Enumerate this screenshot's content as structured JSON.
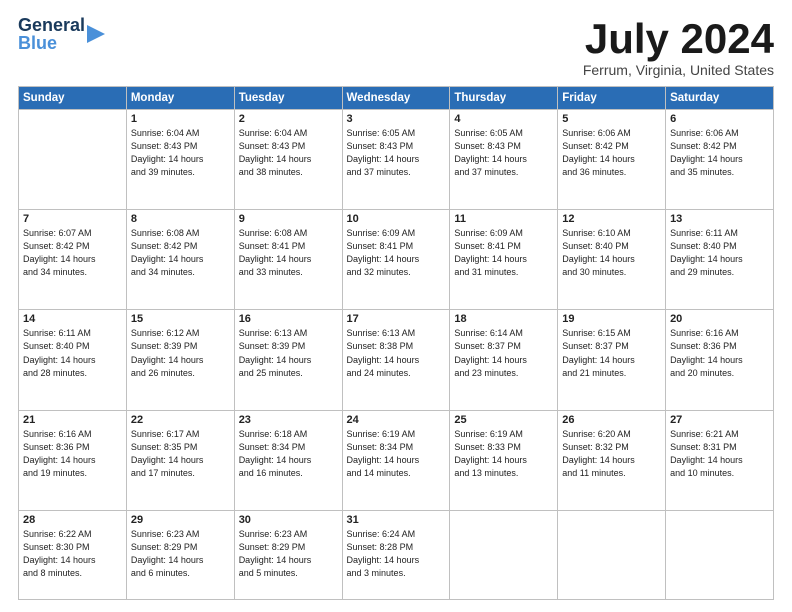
{
  "header": {
    "logo_general": "General",
    "logo_blue": "Blue",
    "month_title": "July 2024",
    "location": "Ferrum, Virginia, United States"
  },
  "days_of_week": [
    "Sunday",
    "Monday",
    "Tuesday",
    "Wednesday",
    "Thursday",
    "Friday",
    "Saturday"
  ],
  "weeks": [
    [
      {
        "day": "",
        "info": ""
      },
      {
        "day": "1",
        "info": "Sunrise: 6:04 AM\nSunset: 8:43 PM\nDaylight: 14 hours\nand 39 minutes."
      },
      {
        "day": "2",
        "info": "Sunrise: 6:04 AM\nSunset: 8:43 PM\nDaylight: 14 hours\nand 38 minutes."
      },
      {
        "day": "3",
        "info": "Sunrise: 6:05 AM\nSunset: 8:43 PM\nDaylight: 14 hours\nand 37 minutes."
      },
      {
        "day": "4",
        "info": "Sunrise: 6:05 AM\nSunset: 8:43 PM\nDaylight: 14 hours\nand 37 minutes."
      },
      {
        "day": "5",
        "info": "Sunrise: 6:06 AM\nSunset: 8:42 PM\nDaylight: 14 hours\nand 36 minutes."
      },
      {
        "day": "6",
        "info": "Sunrise: 6:06 AM\nSunset: 8:42 PM\nDaylight: 14 hours\nand 35 minutes."
      }
    ],
    [
      {
        "day": "7",
        "info": "Sunrise: 6:07 AM\nSunset: 8:42 PM\nDaylight: 14 hours\nand 34 minutes."
      },
      {
        "day": "8",
        "info": "Sunrise: 6:08 AM\nSunset: 8:42 PM\nDaylight: 14 hours\nand 34 minutes."
      },
      {
        "day": "9",
        "info": "Sunrise: 6:08 AM\nSunset: 8:41 PM\nDaylight: 14 hours\nand 33 minutes."
      },
      {
        "day": "10",
        "info": "Sunrise: 6:09 AM\nSunset: 8:41 PM\nDaylight: 14 hours\nand 32 minutes."
      },
      {
        "day": "11",
        "info": "Sunrise: 6:09 AM\nSunset: 8:41 PM\nDaylight: 14 hours\nand 31 minutes."
      },
      {
        "day": "12",
        "info": "Sunrise: 6:10 AM\nSunset: 8:40 PM\nDaylight: 14 hours\nand 30 minutes."
      },
      {
        "day": "13",
        "info": "Sunrise: 6:11 AM\nSunset: 8:40 PM\nDaylight: 14 hours\nand 29 minutes."
      }
    ],
    [
      {
        "day": "14",
        "info": "Sunrise: 6:11 AM\nSunset: 8:40 PM\nDaylight: 14 hours\nand 28 minutes."
      },
      {
        "day": "15",
        "info": "Sunrise: 6:12 AM\nSunset: 8:39 PM\nDaylight: 14 hours\nand 26 minutes."
      },
      {
        "day": "16",
        "info": "Sunrise: 6:13 AM\nSunset: 8:39 PM\nDaylight: 14 hours\nand 25 minutes."
      },
      {
        "day": "17",
        "info": "Sunrise: 6:13 AM\nSunset: 8:38 PM\nDaylight: 14 hours\nand 24 minutes."
      },
      {
        "day": "18",
        "info": "Sunrise: 6:14 AM\nSunset: 8:37 PM\nDaylight: 14 hours\nand 23 minutes."
      },
      {
        "day": "19",
        "info": "Sunrise: 6:15 AM\nSunset: 8:37 PM\nDaylight: 14 hours\nand 21 minutes."
      },
      {
        "day": "20",
        "info": "Sunrise: 6:16 AM\nSunset: 8:36 PM\nDaylight: 14 hours\nand 20 minutes."
      }
    ],
    [
      {
        "day": "21",
        "info": "Sunrise: 6:16 AM\nSunset: 8:36 PM\nDaylight: 14 hours\nand 19 minutes."
      },
      {
        "day": "22",
        "info": "Sunrise: 6:17 AM\nSunset: 8:35 PM\nDaylight: 14 hours\nand 17 minutes."
      },
      {
        "day": "23",
        "info": "Sunrise: 6:18 AM\nSunset: 8:34 PM\nDaylight: 14 hours\nand 16 minutes."
      },
      {
        "day": "24",
        "info": "Sunrise: 6:19 AM\nSunset: 8:34 PM\nDaylight: 14 hours\nand 14 minutes."
      },
      {
        "day": "25",
        "info": "Sunrise: 6:19 AM\nSunset: 8:33 PM\nDaylight: 14 hours\nand 13 minutes."
      },
      {
        "day": "26",
        "info": "Sunrise: 6:20 AM\nSunset: 8:32 PM\nDaylight: 14 hours\nand 11 minutes."
      },
      {
        "day": "27",
        "info": "Sunrise: 6:21 AM\nSunset: 8:31 PM\nDaylight: 14 hours\nand 10 minutes."
      }
    ],
    [
      {
        "day": "28",
        "info": "Sunrise: 6:22 AM\nSunset: 8:30 PM\nDaylight: 14 hours\nand 8 minutes."
      },
      {
        "day": "29",
        "info": "Sunrise: 6:23 AM\nSunset: 8:29 PM\nDaylight: 14 hours\nand 6 minutes."
      },
      {
        "day": "30",
        "info": "Sunrise: 6:23 AM\nSunset: 8:29 PM\nDaylight: 14 hours\nand 5 minutes."
      },
      {
        "day": "31",
        "info": "Sunrise: 6:24 AM\nSunset: 8:28 PM\nDaylight: 14 hours\nand 3 minutes."
      },
      {
        "day": "",
        "info": ""
      },
      {
        "day": "",
        "info": ""
      },
      {
        "day": "",
        "info": ""
      }
    ]
  ]
}
